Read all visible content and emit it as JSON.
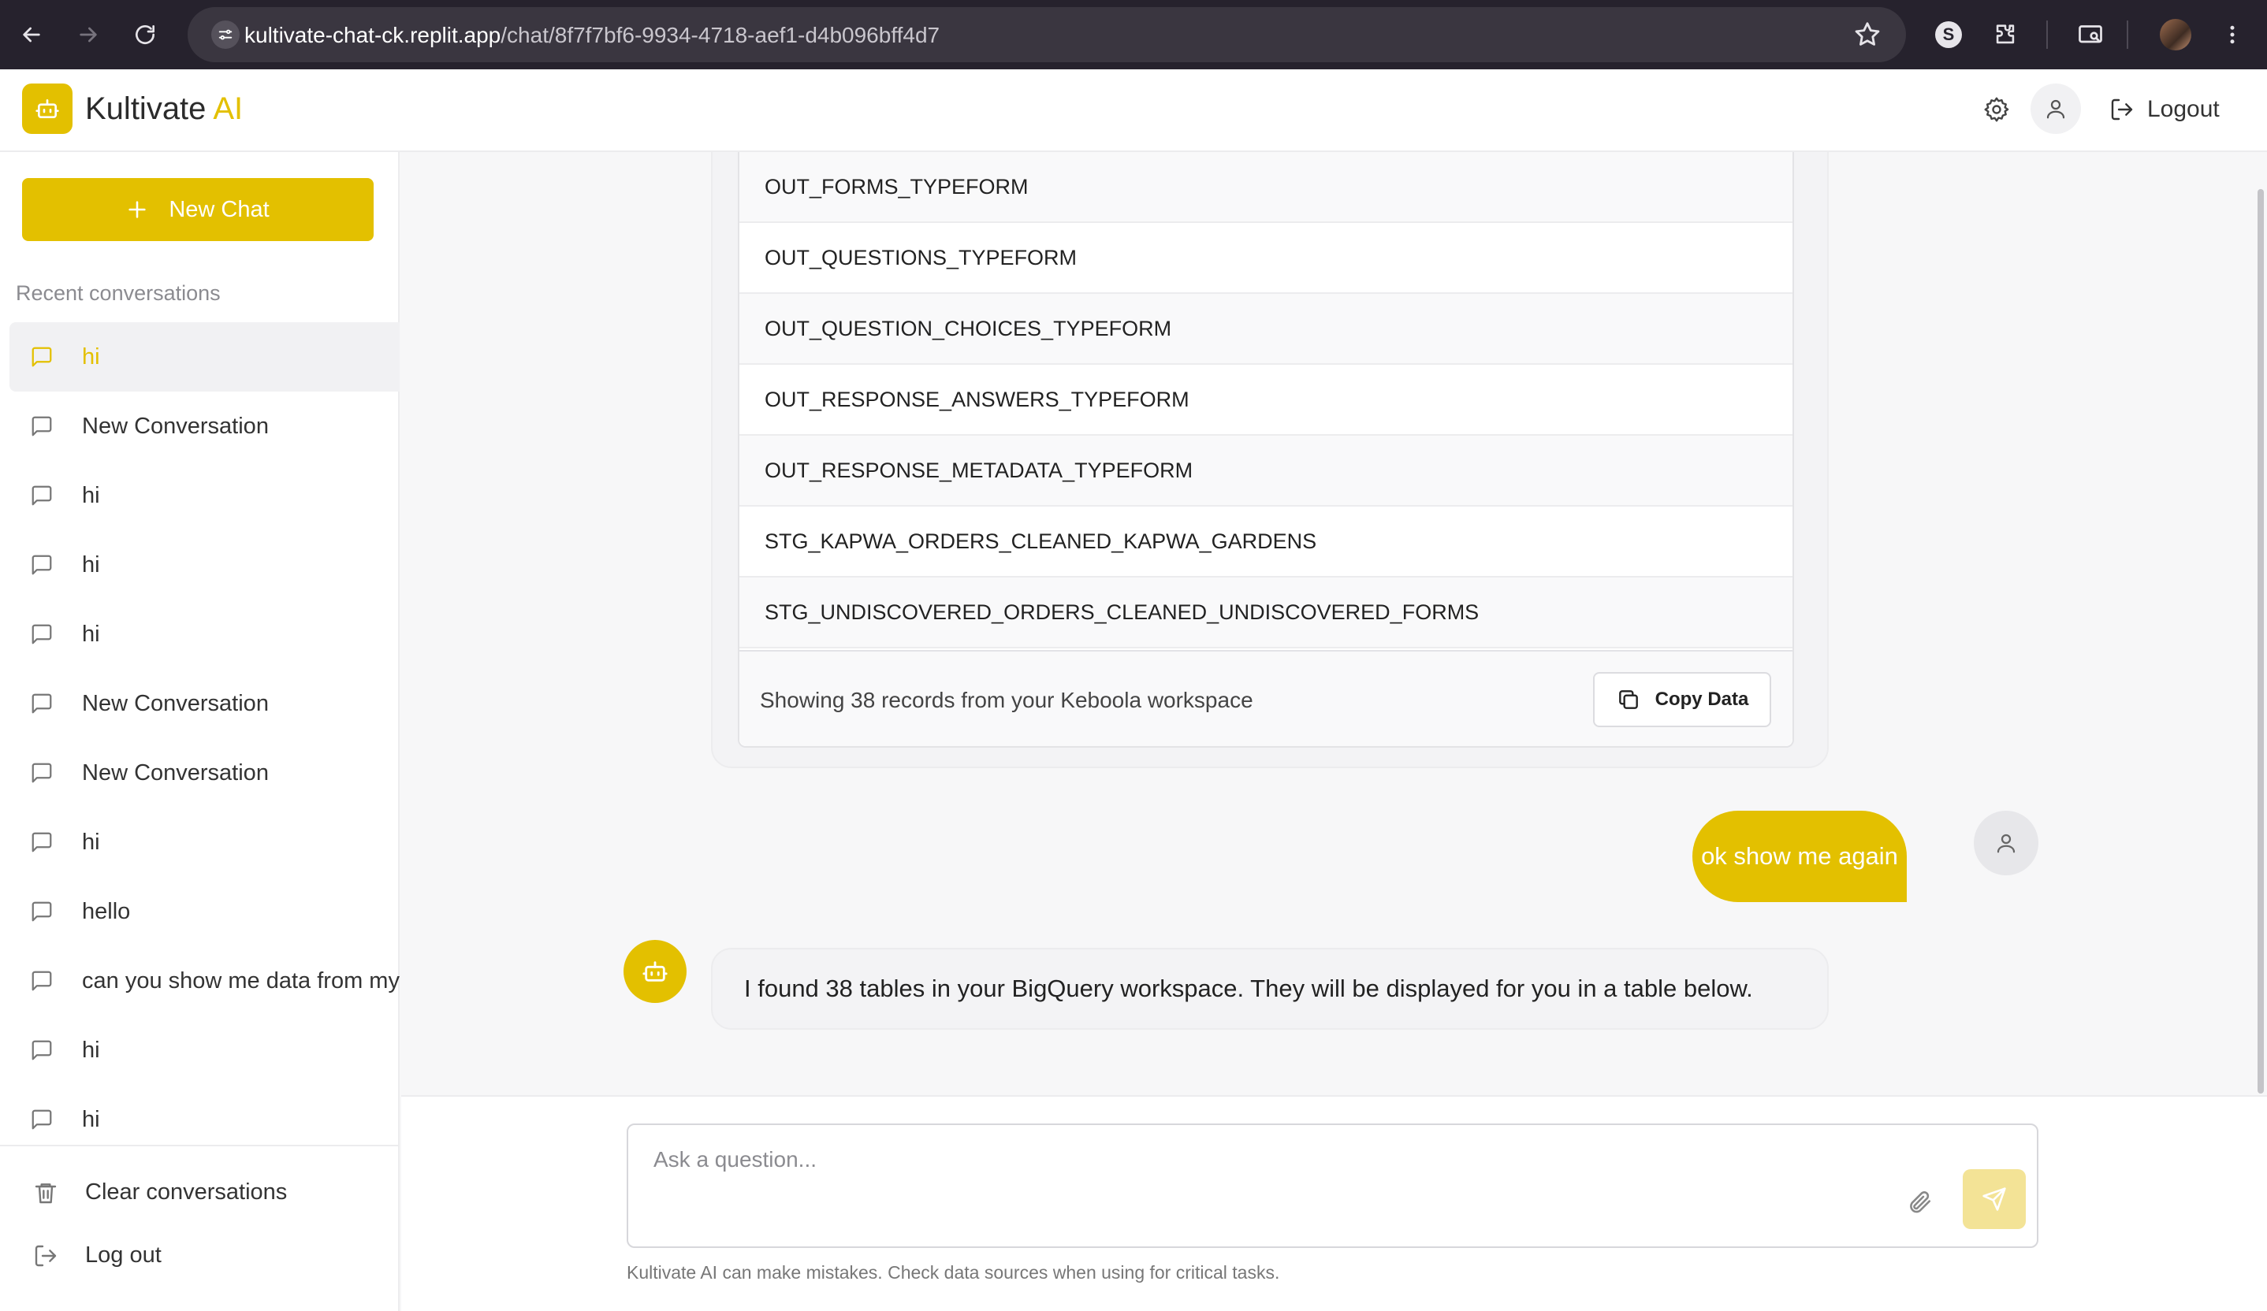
{
  "browser": {
    "url_host": "kultivate-chat-ck.replit.app",
    "url_path": "/chat/8f7f7bf6-9934-4718-aef1-d4b096bff4d7",
    "extension_letter": "S"
  },
  "header": {
    "brand_main": "Kultivate",
    "brand_accent": "AI",
    "logout_label": "Logout"
  },
  "sidebar": {
    "new_chat_label": "New Chat",
    "recent_label": "Recent conversations",
    "conversations": [
      "hi",
      "New Conversation",
      "hi",
      "hi",
      "hi",
      "New Conversation",
      "New Conversation",
      "hi",
      "hello",
      "can you show me data from my",
      "hi",
      "hi"
    ],
    "clear_label": "Clear conversations",
    "logout_label": "Log out"
  },
  "main": {
    "table_rows": [
      "OUT_FORMS_TYPEFORM",
      "OUT_QUESTIONS_TYPEFORM",
      "OUT_QUESTION_CHOICES_TYPEFORM",
      "OUT_RESPONSE_ANSWERS_TYPEFORM",
      "OUT_RESPONSE_METADATA_TYPEFORM",
      "STG_KAPWA_ORDERS_CLEANED_KAPWA_GARDENS",
      "STG_UNDISCOVERED_ORDERS_CLEANED_UNDISCOVERED_FORMS"
    ],
    "table_footer": "Showing 38 records from your Keboola workspace",
    "copy_label": "Copy Data",
    "user_message": "ok show me again",
    "bot_message": "I found 38 tables in your BigQuery workspace. They will be displayed for you in a table below."
  },
  "composer": {
    "placeholder": "Ask a question...",
    "disclaimer": "Kultivate AI can make mistakes. Check data sources when using for critical tasks."
  },
  "colors": {
    "accent": "#e3c000",
    "accent_light": "#f3e396",
    "chrome_bg": "#26222d"
  }
}
